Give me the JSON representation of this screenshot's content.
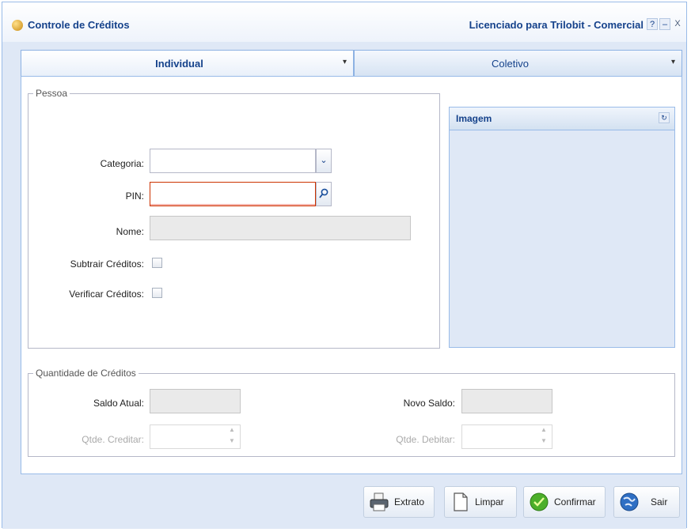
{
  "window": {
    "title": "Controle de Créditos",
    "license": "Licenciado para Trilobit - Comercial",
    "help_glyph": "?",
    "minimize_glyph": "–",
    "close_glyph": "X"
  },
  "tabs": [
    {
      "label": "Individual",
      "active": true,
      "arrow": "▾"
    },
    {
      "label": "Coletivo",
      "active": false,
      "arrow": "▾"
    }
  ],
  "pessoa": {
    "legend": "Pessoa",
    "categoria_label": "Categoria:",
    "categoria_value": "",
    "pin_label": "PIN:",
    "pin_value": "",
    "nome_label": "Nome:",
    "nome_value": "",
    "subtrair_label": "Subtrair Créditos:",
    "verificar_label": "Verificar Créditos:"
  },
  "imagem": {
    "title": "Imagem"
  },
  "quantidade": {
    "legend": "Quantidade de Créditos",
    "saldo_atual_label": "Saldo Atual:",
    "saldo_atual_value": "",
    "novo_saldo_label": "Novo Saldo:",
    "novo_saldo_value": "",
    "qtde_creditar_label": "Qtde. Creditar:",
    "qtde_debitar_label": "Qtde. Debitar:"
  },
  "buttons": {
    "extrato": "Extrato",
    "limpar": "Limpar",
    "confirmar": "Confirmar",
    "sair": "Sair"
  },
  "colors": {
    "accent": "#15428b",
    "window_bg": "#dfe8f6",
    "invalid_border": "#cc3300"
  },
  "icons": {
    "app": "coins-icon",
    "categoria_trigger": "chevron-down-icon",
    "pin_trigger": "search-icon",
    "extrato": "printer-icon",
    "limpar": "blank-page-icon",
    "confirmar": "green-check-icon",
    "sair": "exit-globe-icon"
  }
}
